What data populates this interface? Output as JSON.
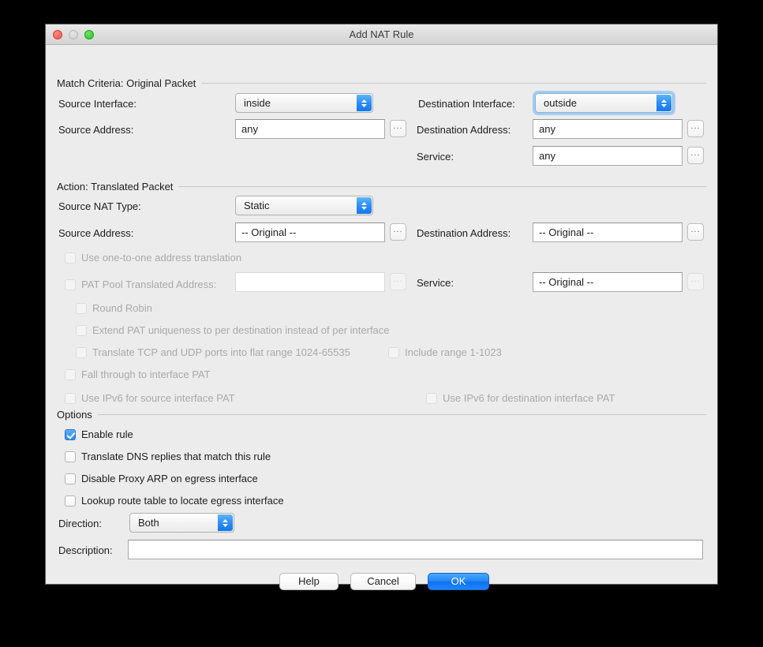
{
  "window": {
    "title": "Add NAT Rule",
    "traffic_lights": [
      "close",
      "minimize",
      "zoom"
    ]
  },
  "sections": {
    "match_criteria": {
      "heading": "Match Criteria: Original Packet",
      "source_interface": {
        "label": "Source Interface:",
        "value": "inside"
      },
      "source_address": {
        "label": "Source Address:",
        "value": "any",
        "browse": "..."
      },
      "destination_interface": {
        "label": "Destination Interface:",
        "value": "outside",
        "focused": true
      },
      "destination_address": {
        "label": "Destination Address:",
        "value": "any",
        "browse": "..."
      },
      "service": {
        "label": "Service:",
        "value": "any",
        "browse": "..."
      }
    },
    "action": {
      "heading": "Action: Translated Packet",
      "source_nat_type": {
        "label": "Source NAT Type:",
        "value": "Static"
      },
      "source_address": {
        "label": "Source Address:",
        "value": "-- Original --",
        "browse": "..."
      },
      "destination_address": {
        "label": "Destination Address:",
        "value": "-- Original --",
        "browse": "..."
      },
      "one_to_one": {
        "label": "Use one-to-one address translation",
        "checked": false,
        "enabled": false
      },
      "pat_pool": {
        "label": "PAT Pool Translated Address:",
        "value": "",
        "checked": false,
        "enabled": false,
        "browse": "..."
      },
      "service": {
        "label": "Service:",
        "value": "-- Original --",
        "browse": "..."
      },
      "round_robin": {
        "label": "Round Robin",
        "checked": false,
        "enabled": false
      },
      "extend_pat": {
        "label": "Extend PAT uniqueness to per destination instead of per interface",
        "checked": false,
        "enabled": false
      },
      "flat_range": {
        "label": "Translate TCP and UDP ports into flat range 1024-65535",
        "checked": false,
        "enabled": false
      },
      "include_range": {
        "label": "Include range 1-1023",
        "checked": false,
        "enabled": false
      },
      "fall_through": {
        "label": "Fall through to interface PAT",
        "checked": false,
        "enabled": false
      },
      "ipv6_source": {
        "label": "Use IPv6 for source interface PAT",
        "checked": false,
        "enabled": false
      },
      "ipv6_destination": {
        "label": "Use IPv6 for destination interface PAT",
        "checked": false,
        "enabled": false
      }
    },
    "options": {
      "heading": "Options",
      "enable_rule": {
        "label": "Enable rule",
        "checked": true,
        "enabled": true
      },
      "translate_dns": {
        "label": "Translate DNS replies that match this rule",
        "checked": false,
        "enabled": true
      },
      "disable_proxy_arp": {
        "label": "Disable Proxy ARP on egress interface",
        "checked": false,
        "enabled": true
      },
      "lookup_route": {
        "label": "Lookup route table to locate egress interface",
        "checked": false,
        "enabled": true
      },
      "direction": {
        "label": "Direction:",
        "value": "Both"
      },
      "description": {
        "label": "Description:",
        "value": ""
      }
    }
  },
  "buttons": {
    "help": "Help",
    "cancel": "Cancel",
    "ok": "OK"
  },
  "colors": {
    "accent": "#2a8bf2",
    "window_bg": "#ececec",
    "disabled_text": "#a9a9a9"
  }
}
